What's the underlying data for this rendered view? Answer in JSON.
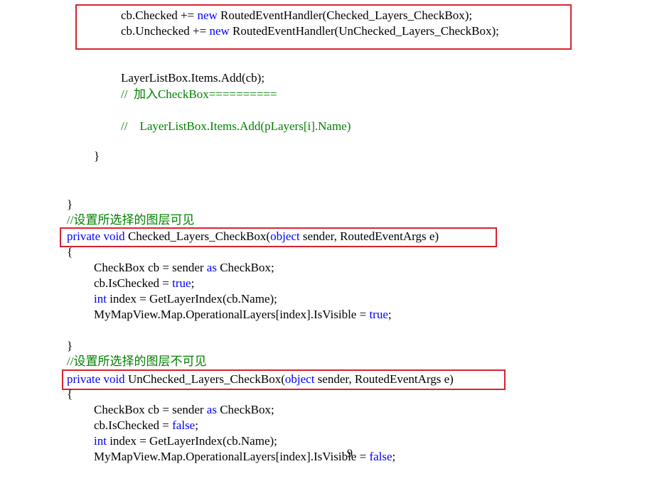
{
  "colors": {
    "keyword": "#0000ff",
    "comment": "#008000",
    "highlight_box": "#d9232e",
    "text": "#000000"
  },
  "code": {
    "l1": {
      "a": "cb.Checked += ",
      "kw": "new",
      "b": " RoutedEventHandler(Checked_Layers_CheckBox);"
    },
    "l2": {
      "a": "cb.Unchecked += ",
      "kw": "new",
      "b": " RoutedEventHandler(UnChecked_Layers_CheckBox);"
    },
    "l3": "LayerListBox.Items.Add(cb);",
    "l4": "//  加入CheckBox==========",
    "l5": "//    LayerListBox.Items.Add(pLayers[i].Name)",
    "l6": "}",
    "l7": "}",
    "l8": "//设置所选择的图层可见",
    "l9": {
      "kw1": "private",
      "sp1": " ",
      "kw2": "void",
      "a": " Checked_Layers_CheckBox(",
      "kw3": "object",
      "b": " sender, RoutedEventArgs e)"
    },
    "l10": "{",
    "l11": {
      "a": "CheckBox cb = sender ",
      "kw": "as",
      "b": " CheckBox;"
    },
    "l12": {
      "a": "cb.IsChecked = ",
      "kw": "true",
      "b": ";"
    },
    "l13": {
      "kw": "int",
      "a": " index = GetLayerIndex(cb.Name);"
    },
    "l14": {
      "a": "MyMapView.Map.OperationalLayers[index].IsVisible = ",
      "kw": "true",
      "b": ";"
    },
    "l15": "}",
    "l16": "//设置所选择的图层不可见",
    "l17": {
      "kw1": "private",
      "sp1": " ",
      "kw2": "void",
      "a": " UnChecked_Layers_CheckBox(",
      "kw3": "object",
      "b": " sender, RoutedEventArgs e)"
    },
    "l18": "{",
    "l19": {
      "a": "CheckBox cb = sender ",
      "kw": "as",
      "b": " CheckBox;"
    },
    "l20": {
      "a": "cb.IsChecked = ",
      "kw": "false",
      "b": ";"
    },
    "l21": {
      "kw": "int",
      "a": " index = GetLayerIndex(cb.Name);"
    },
    "l22": {
      "a": "MyMapView.Map.OperationalLayers[index].IsVisible = ",
      "kw": "false",
      "b": ";"
    }
  },
  "page_number": "9"
}
